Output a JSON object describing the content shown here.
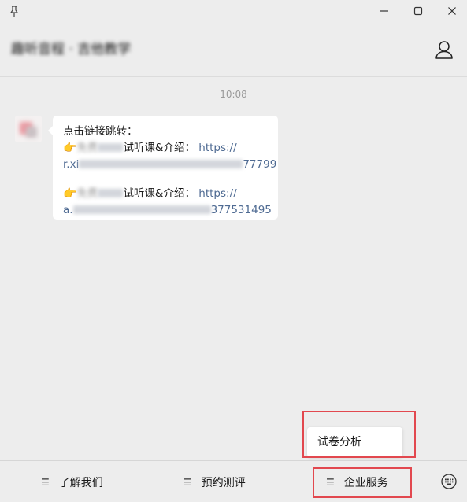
{
  "window": {
    "pin_icon": "pin-icon",
    "minimize_icon": "minimize-icon",
    "maximize_icon": "maximize-icon",
    "close_icon": "close-icon"
  },
  "header": {
    "title": "趣听音程 · 吉他教学",
    "profile_icon": "person-icon"
  },
  "chat": {
    "timestamp": "10:08",
    "message": {
      "intro": "点击链接跳转：",
      "item1_prefix": "免费",
      "item1_text": "试听课&介绍：",
      "item1_link_a": "https://",
      "item1_link_b_start": "r.xi",
      "item1_link_b_end": "77799",
      "item2_prefix": "免费",
      "item2_text": "试听课&介绍：",
      "item2_link_a": "https://",
      "item2_link_b_start": "a.",
      "item2_link_b_end": "377531495",
      "hand_icon": "pointing-hand-icon"
    }
  },
  "popup_menu": {
    "item": "试卷分析"
  },
  "bottom_menu": {
    "items": [
      {
        "label": "了解我们",
        "icon": "menu-lines-icon"
      },
      {
        "label": "预约测评",
        "icon": "menu-lines-icon"
      },
      {
        "label": "企业服务",
        "icon": "menu-lines-icon"
      }
    ],
    "keyboard_icon": "keyboard-icon"
  },
  "colors": {
    "background": "#ededed",
    "bubble": "#ffffff",
    "link": "#4e6a92",
    "highlight": "#e2484f"
  }
}
